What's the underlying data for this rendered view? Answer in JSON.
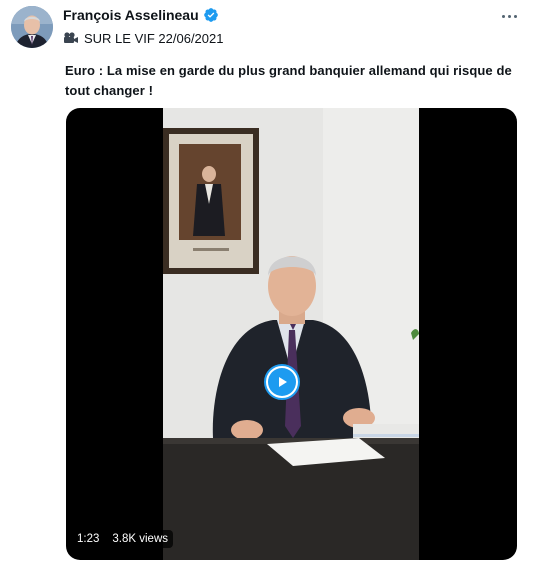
{
  "author": {
    "name": "François Asselineau",
    "verified": true,
    "verified_color": "#1d9bf0"
  },
  "subline": {
    "icon": "movie-camera-icon",
    "text": "SUR LE VIF 22/06/2021"
  },
  "tweet": {
    "text": "Euro : La mise en garde du plus grand banquier allemand qui risque de tout changer !"
  },
  "media": {
    "type": "video",
    "duration": "1:23",
    "views": "3.8K views",
    "accent": "#1d9bf0"
  },
  "menu": {
    "icon": "more-icon"
  }
}
